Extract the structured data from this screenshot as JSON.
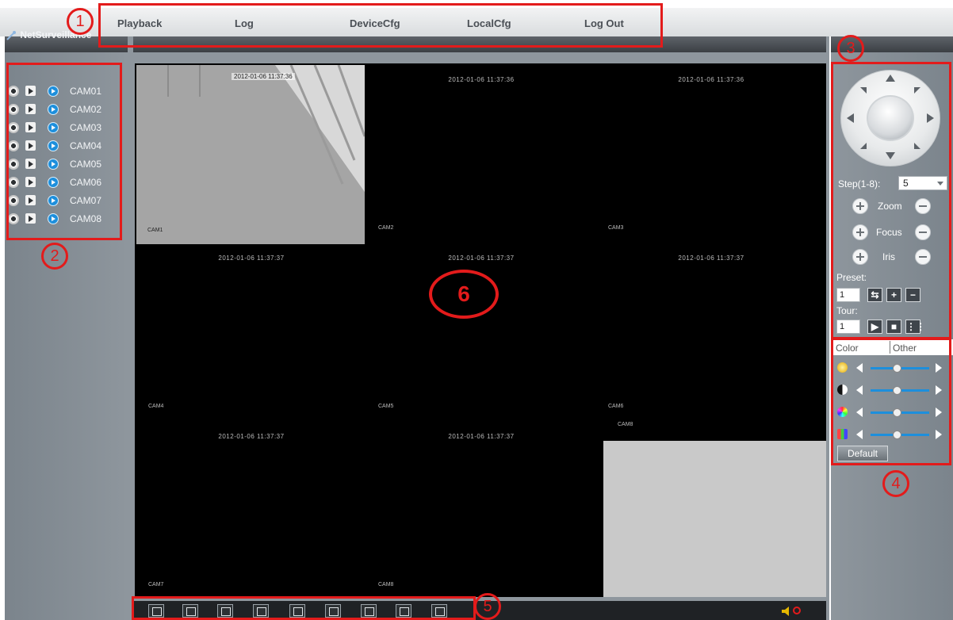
{
  "top_menu": {
    "items": [
      {
        "label": "Playback"
      },
      {
        "label": "Log"
      },
      {
        "label": "DeviceCfg"
      },
      {
        "label": "LocalCfg"
      },
      {
        "label": "Log Out"
      }
    ]
  },
  "device_tree": {
    "root_label": "NetSurveillance",
    "cameras": [
      "CAM01",
      "CAM02",
      "CAM03",
      "CAM04",
      "CAM05",
      "CAM06",
      "CAM07",
      "CAM08"
    ]
  },
  "video_grid": {
    "live_feed": {
      "timestamp": "2012-01-06 11:37:36",
      "cam_tag": "CAM1"
    },
    "cells": [
      {
        "timestamp": "2012-01-06 11:37:36",
        "cam_tag": "CAM2"
      },
      {
        "timestamp": "2012-01-06 11:37:36",
        "cam_tag": "CAM3"
      },
      {
        "timestamp": "2012-01-06 11:37:37",
        "cam_tag": "CAM4"
      },
      {
        "timestamp": "2012-01-06 11:37:37",
        "cam_tag": "CAM5"
      },
      {
        "timestamp": "2012-01-06 11:37:37",
        "cam_tag": "CAM6"
      },
      {
        "timestamp": "2012-01-06 11:37:37",
        "cam_tag": "CAM7"
      },
      {
        "timestamp": "2012-01-06 11:37:37",
        "cam_tag": "CAM8"
      }
    ],
    "extra_tag": "CAM8"
  },
  "toolbar": {
    "buttons": [
      "fullscreen-icon",
      "single-view-icon",
      "quad-view-icon",
      "nine-view-icon",
      "record-start-icon",
      "record-stop-icon",
      "snapshot-icon",
      "talk-icon",
      "talk-stop-icon"
    ]
  },
  "ptz": {
    "step_label": "Step(1-8):",
    "step_value": "5",
    "zoom_label": "Zoom",
    "focus_label": "Focus",
    "iris_label": "Iris",
    "preset_label": "Preset:",
    "preset_value": "1",
    "tour_label": "Tour:",
    "tour_value": "1"
  },
  "image_settings": {
    "tabs": [
      "Color",
      "Other"
    ],
    "sliders": [
      {
        "name": "brightness",
        "level": 0.45
      },
      {
        "name": "contrast",
        "level": 0.45
      },
      {
        "name": "saturation",
        "level": 0.45
      },
      {
        "name": "hue",
        "level": 0.45
      }
    ],
    "default_label": "Default"
  },
  "annotations": [
    "1",
    "2",
    "3",
    "4",
    "5",
    "6"
  ],
  "colors": {
    "accent": "#1d8fdc",
    "annotation": "#e31b1b",
    "panel": "#8e969d"
  }
}
